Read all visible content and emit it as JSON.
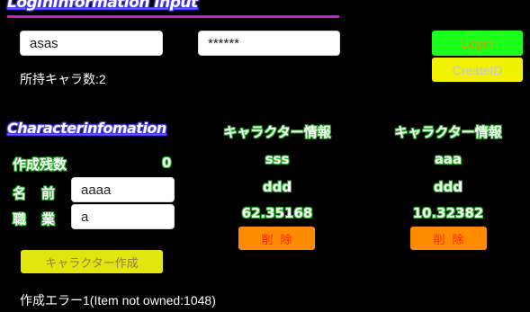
{
  "login_section": {
    "heading": "LogInInformation Input",
    "username_value": "asas",
    "password_value": "******",
    "owned_characters_label": "所持キャラ数:2",
    "login_button": "Login",
    "create_id_button": "CreateID"
  },
  "character_section": {
    "heading": "Characterinfomation",
    "remaining_label": "作成残数",
    "remaining_value": "0",
    "name_label": "名　前",
    "name_value": "aaaa",
    "job_label": "職　業",
    "job_value": "a",
    "create_button": "キャラクター作成",
    "error_message": "作成エラー1(Item not owned:1048)"
  },
  "characters": [
    {
      "title": "キャラクター情報",
      "name": "sss",
      "job": "ddd",
      "value": "62.35168",
      "delete_button": "削除"
    },
    {
      "title": "キャラクター情報",
      "name": "aaa",
      "job": "ddd",
      "value": "10.32382",
      "delete_button": "削除"
    }
  ],
  "colors": {
    "background": "#000000",
    "login_button": "#1cff1c",
    "create_id_button": "#f2f200",
    "create_char_button": "#e0e60e",
    "delete_button": "#ff8c00",
    "heading_underline": "#cc22cc"
  }
}
